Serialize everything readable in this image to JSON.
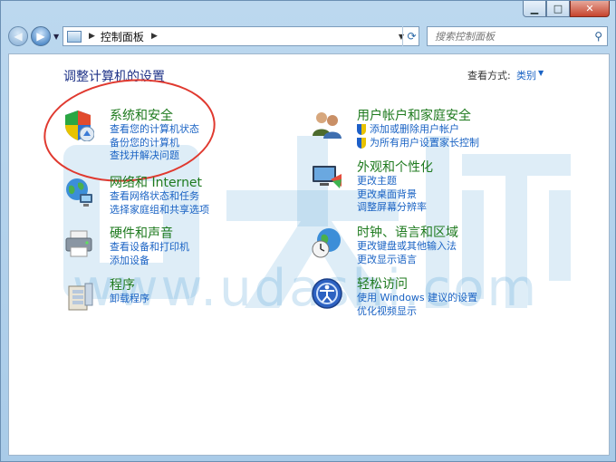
{
  "address": {
    "crumb": "控制面板"
  },
  "search": {
    "placeholder": "搜索控制面板"
  },
  "content": {
    "heading": "调整计算机的设置",
    "view_by_label": "查看方式:",
    "view_by_value": "类别"
  },
  "categories": [
    {
      "title": "系统和安全",
      "links": [
        "查看您的计算机状态",
        "备份您的计算机",
        "查找并解决问题"
      ],
      "icon": "shield-icon"
    },
    {
      "title": "网络和 Internet",
      "links": [
        "查看网络状态和任务",
        "选择家庭组和共享选项"
      ],
      "icon": "network-globe-icon"
    },
    {
      "title": "硬件和声音",
      "links": [
        "查看设备和打印机",
        "添加设备"
      ],
      "icon": "printer-icon"
    },
    {
      "title": "程序",
      "links": [
        "卸载程序"
      ],
      "icon": "programs-icon"
    },
    {
      "title": "用户帐户和家庭安全",
      "links": [
        "添加或删除用户帐户",
        "为所有用户设置家长控制"
      ],
      "icon": "users-icon"
    },
    {
      "title": "外观和个性化",
      "links": [
        "更改主题",
        "更改桌面背景",
        "调整屏幕分辨率"
      ],
      "icon": "monitor-icon"
    },
    {
      "title": "时钟、语言和区域",
      "links": [
        "更改键盘或其他输入法",
        "更改显示语言"
      ],
      "icon": "clock-globe-icon"
    },
    {
      "title": "轻松访问",
      "links": [
        "使用 Windows 建议的设置",
        "优化视频显示"
      ],
      "icon": "ease-of-access-icon"
    }
  ],
  "watermark": {
    "text": "www.udashi.com"
  }
}
